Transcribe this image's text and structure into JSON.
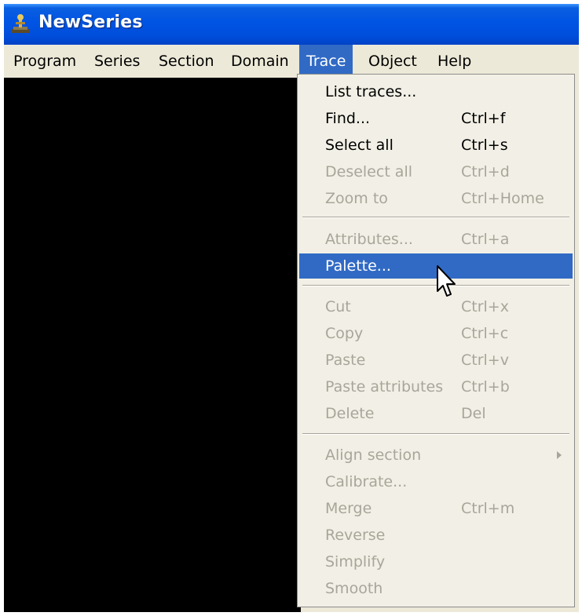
{
  "window": {
    "title": "NewSeries"
  },
  "menubar": {
    "items": [
      {
        "label": "Program"
      },
      {
        "label": "Series"
      },
      {
        "label": "Section"
      },
      {
        "label": "Domain"
      },
      {
        "label": "Trace",
        "active": true
      },
      {
        "label": "Object"
      },
      {
        "label": "Help"
      }
    ]
  },
  "trace_menu": {
    "items": [
      {
        "label": "List traces...",
        "shortcut": "",
        "enabled": true
      },
      {
        "label": "Find...",
        "shortcut": "Ctrl+f",
        "enabled": true
      },
      {
        "label": "Select all",
        "shortcut": "Ctrl+s",
        "enabled": true
      },
      {
        "label": "Deselect all",
        "shortcut": "Ctrl+d",
        "enabled": false
      },
      {
        "label": "Zoom to",
        "shortcut": "Ctrl+Home",
        "enabled": false
      },
      {
        "label": "Attributes...",
        "shortcut": "Ctrl+a",
        "enabled": false
      },
      {
        "label": "Palette...",
        "shortcut": "",
        "enabled": true,
        "highlighted": true
      },
      {
        "label": "Cut",
        "shortcut": "Ctrl+x",
        "enabled": false
      },
      {
        "label": "Copy",
        "shortcut": "Ctrl+c",
        "enabled": false
      },
      {
        "label": "Paste",
        "shortcut": "Ctrl+v",
        "enabled": false
      },
      {
        "label": "Paste attributes",
        "shortcut": "Ctrl+b",
        "enabled": false
      },
      {
        "label": "Delete",
        "shortcut": "Del",
        "enabled": false
      },
      {
        "label": "Align section",
        "shortcut": "",
        "enabled": false,
        "submenu": true
      },
      {
        "label": "Calibrate...",
        "shortcut": "",
        "enabled": false
      },
      {
        "label": "Merge",
        "shortcut": "Ctrl+m",
        "enabled": false
      },
      {
        "label": "Reverse",
        "shortcut": "",
        "enabled": false
      },
      {
        "label": "Simplify",
        "shortcut": "",
        "enabled": false
      },
      {
        "label": "Smooth",
        "shortcut": "",
        "enabled": false
      }
    ]
  },
  "colors": {
    "titlebar": "#0054e3",
    "menu_highlight": "#316ac5",
    "disabled_text": "#a8a59a",
    "canvas": "#000000"
  }
}
